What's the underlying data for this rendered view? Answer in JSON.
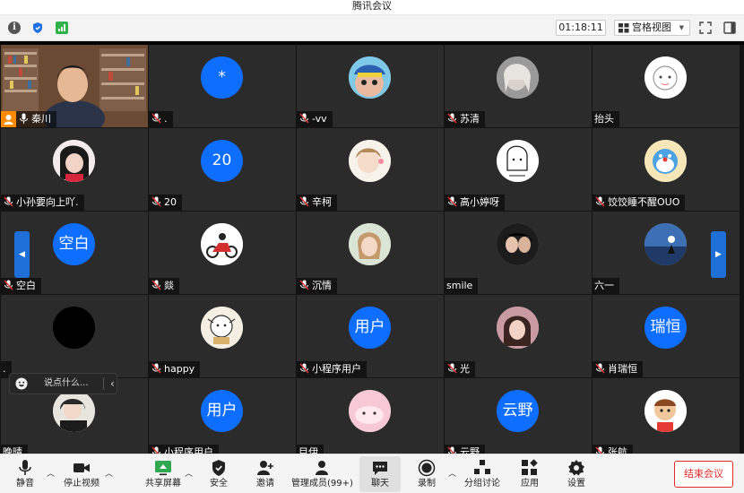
{
  "window": {
    "title": "腾讯会议"
  },
  "infobar": {
    "timer": "01:18:11",
    "view_mode": "宫格视图",
    "icons": [
      "info-icon",
      "shield-icon",
      "signal-icon",
      "fullscreen-icon",
      "sidepanel-icon"
    ]
  },
  "colors": {
    "avatar_blue": "#0e6eff",
    "end_red": "#e02a2a",
    "host_badge": "#ff8a00",
    "tile_bg": "#2b2b2b"
  },
  "participants": [
    {
      "name": "秦川",
      "avatar": "video"
    },
    {
      "name": ".",
      "avatar": "blue",
      "initial": "*"
    },
    {
      "name": "-vv",
      "avatar": "photo"
    },
    {
      "name": "苏清",
      "avatar": "photo"
    },
    {
      "name": "抬头",
      "avatar": "photo"
    },
    {
      "name": "小孙要向上吖.",
      "avatar": "photo"
    },
    {
      "name": "20",
      "avatar": "blue",
      "initial": "20"
    },
    {
      "name": "辛柯",
      "avatar": "photo"
    },
    {
      "name": "高小婷呀",
      "avatar": "photo"
    },
    {
      "name": "饺饺睡不醒OUO",
      "avatar": "photo"
    },
    {
      "name": "空白",
      "avatar": "blue",
      "initial": "空白"
    },
    {
      "name": "燚",
      "avatar": "photo"
    },
    {
      "name": "沉情",
      "avatar": "photo"
    },
    {
      "name": "smile",
      "avatar": "photo"
    },
    {
      "name": "六一",
      "avatar": "photo"
    },
    {
      "name": ".",
      "avatar": "black"
    },
    {
      "name": "happy",
      "avatar": "photo"
    },
    {
      "name": "小程序用户",
      "avatar": "blue",
      "initial": "用户"
    },
    {
      "name": "光",
      "avatar": "photo"
    },
    {
      "name": "肖瑞恒",
      "avatar": "blue",
      "initial": "瑞恒"
    },
    {
      "name": "晚晴",
      "avatar": "photo"
    },
    {
      "name": "小程序用户",
      "avatar": "blue",
      "initial": "用户"
    },
    {
      "name": "目伊",
      "avatar": "photo"
    },
    {
      "name": "云野",
      "avatar": "blue",
      "initial": "云野"
    },
    {
      "name": "张航",
      "avatar": "photo"
    }
  ],
  "chat": {
    "placeholder": "说点什么..."
  },
  "toolbar": {
    "mute": "静音",
    "stop_video": "停止视频",
    "share_screen": "共享屏幕",
    "security": "安全",
    "invite": "邀请",
    "manage_members": "管理成员(99+)",
    "chat": "聊天",
    "record": "录制",
    "breakout": "分组讨论",
    "apps": "应用",
    "settings": "设置",
    "end_meeting": "结束会议"
  }
}
